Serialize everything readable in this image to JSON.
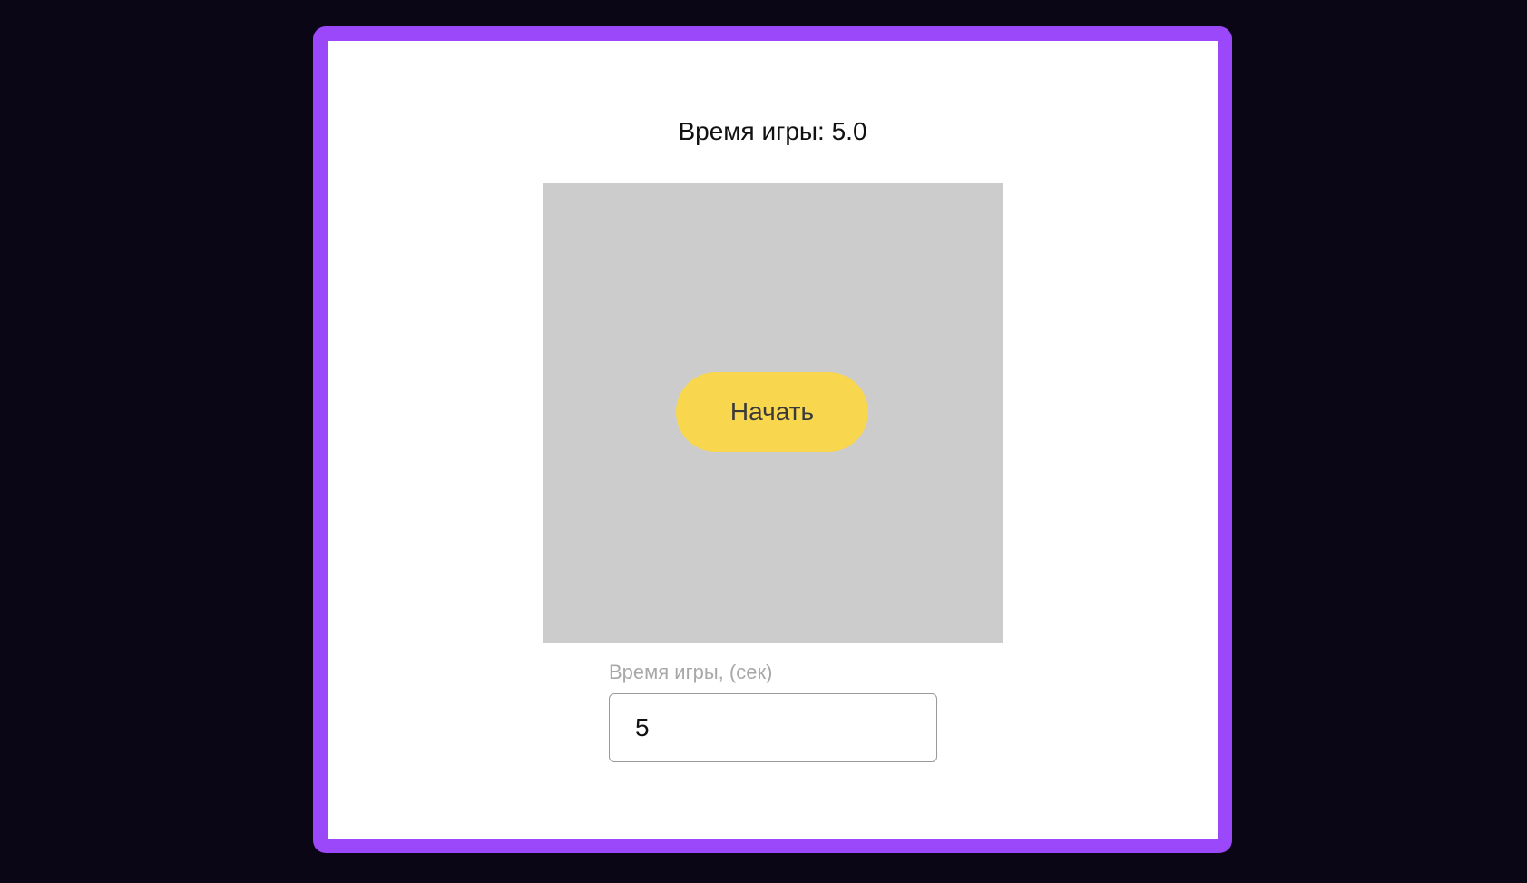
{
  "theme": {
    "page_background": "#0b0616",
    "frame_color": "#9b48fa",
    "card_background": "#ffffff",
    "game_area_color": "#cccccc",
    "start_button_color": "#f8d64e"
  },
  "header": {
    "timer_text": "Время игры: 5.0"
  },
  "game": {
    "start_label": "Начать"
  },
  "settings": {
    "duration_label": "Время игры, (сек)",
    "duration_value": "5"
  }
}
